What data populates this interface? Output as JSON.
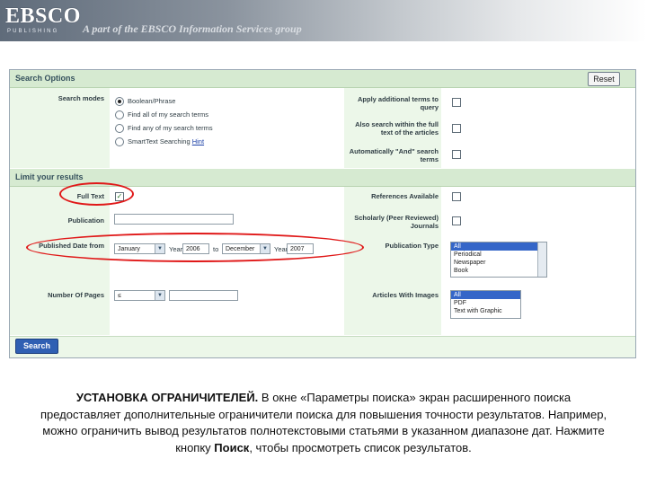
{
  "header": {
    "logo": "EBSCO",
    "logo_sub": "PUBLISHING",
    "tagline": "A part of the EBSCO Information Services group"
  },
  "search_options": {
    "title": "Search Options",
    "reset_label": "Reset",
    "search_modes_label": "Search modes",
    "modes": [
      {
        "label": "Boolean/Phrase",
        "selected": true
      },
      {
        "label": "Find all of my search terms",
        "selected": false
      },
      {
        "label": "Find any of my search terms",
        "selected": false
      },
      {
        "label": "SmartText Searching",
        "hint": "Hint",
        "selected": false
      }
    ],
    "apply_terms_label": "Apply additional terms to query",
    "also_search_label": "Also search within the full text of the articles",
    "auto_and_label": "Automatically \"And\" search terms"
  },
  "limit": {
    "title": "Limit your results",
    "full_text_label": "Full Text",
    "full_text_checked": true,
    "references_label": "References Available",
    "publication_label": "Publication",
    "publication_value": "",
    "scholarly_label": "Scholarly (Peer Reviewed) Journals",
    "published_label": "Published Date from",
    "from_month": "January",
    "year_label": "Year:",
    "from_year": "2006",
    "to_label": "to",
    "to_month": "December",
    "to_year": "2007",
    "pub_type_label": "Publication Type",
    "pub_types": [
      "All",
      "Periodical",
      "Newspaper",
      "Book"
    ],
    "pages_label": "Number Of Pages",
    "pages_select": "≤",
    "pages_value": "",
    "images_label": "Articles With Images",
    "images": [
      "All",
      "PDF",
      "Text with Graphic"
    ]
  },
  "search_button": "Search",
  "caption": {
    "bold": "УСТАНОВКА ОГРАНИЧИТЕЛЕЙ.",
    "part1": " В окне «Параметры поиска» экран расширенного поиска предоставляет дополнительные ограничители поиска для повышения точности результатов. Например, можно ограничить вывод результатов полнотекстовыми статьями в указанном диапазоне дат. Нажмите кнопку ",
    "bold2": "Поиск",
    "part2": ", чтобы просмотреть список результатов."
  },
  "colors": {
    "label_column": "#ecf7e9",
    "section_bar": "#d6ead1",
    "highlight": "#e01818",
    "search_button": "#2f5fb3"
  }
}
